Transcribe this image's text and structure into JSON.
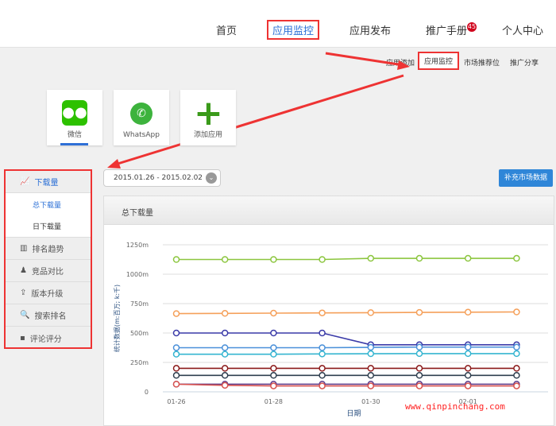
{
  "nav": {
    "items": [
      "首页",
      "应用监控",
      "应用发布",
      "推广手册",
      "个人中心"
    ],
    "badge": "45"
  },
  "subnav": [
    "应用添加",
    "应用监控",
    "市场推荐位",
    "推广分享"
  ],
  "apps": [
    {
      "name": "微信",
      "icon": "wechat-icon"
    },
    {
      "name": "WhatsApp",
      "icon": "whatsapp-icon"
    },
    {
      "name": "添加应用",
      "icon": "plus-icon"
    }
  ],
  "sidebar": {
    "items": [
      "下载量",
      "总下载量",
      "日下载量",
      "排名趋势",
      "竞品对比",
      "版本升级",
      "搜索排名",
      "评论评分"
    ]
  },
  "date_range": "2015.01.26 - 2015.02.02",
  "supplement_button": "补充市场数据",
  "panel_title": "总下载量",
  "watermark": "www.qinpinchang.com",
  "chart_data": {
    "type": "line",
    "xlabel": "日期",
    "ylabel": "统计数据(m:百万; k:千)",
    "x": [
      "01-26",
      "01-27",
      "01-28",
      "01-29",
      "01-30",
      "01-31",
      "02-01",
      "02-02"
    ],
    "xticks": [
      "01-26",
      "01-28",
      "01-30",
      "02-01"
    ],
    "yticks": [
      "0",
      "250m",
      "500m",
      "750m",
      "1000m",
      "1250m"
    ],
    "ylim": [
      0,
      1250
    ],
    "grid": true,
    "series": [
      {
        "color": "#8cc63f",
        "values": [
          1125,
          1125,
          1125,
          1125,
          1135,
          1135,
          1135,
          1135
        ]
      },
      {
        "color": "#f5a05a",
        "values": [
          665,
          667,
          669,
          671,
          673,
          675,
          677,
          679
        ]
      },
      {
        "color": "#3a3aa8",
        "values": [
          500,
          500,
          500,
          500,
          400,
          400,
          400,
          400
        ]
      },
      {
        "color": "#4a90d9",
        "values": [
          375,
          375,
          375,
          375,
          378,
          380,
          380,
          380
        ]
      },
      {
        "color": "#35b5d0",
        "values": [
          320,
          320,
          320,
          322,
          324,
          325,
          325,
          325
        ]
      },
      {
        "color": "#8b1a1a",
        "values": [
          200,
          200,
          200,
          200,
          200,
          200,
          200,
          200
        ]
      },
      {
        "color": "#2f3f4f",
        "values": [
          140,
          140,
          140,
          140,
          140,
          140,
          140,
          140
        ]
      },
      {
        "color": "#5b3a8a",
        "values": [
          65,
          65,
          65,
          65,
          65,
          65,
          65,
          65
        ]
      },
      {
        "color": "#d9534f",
        "values": [
          65,
          55,
          50,
          50,
          50,
          50,
          50,
          50
        ]
      }
    ]
  }
}
